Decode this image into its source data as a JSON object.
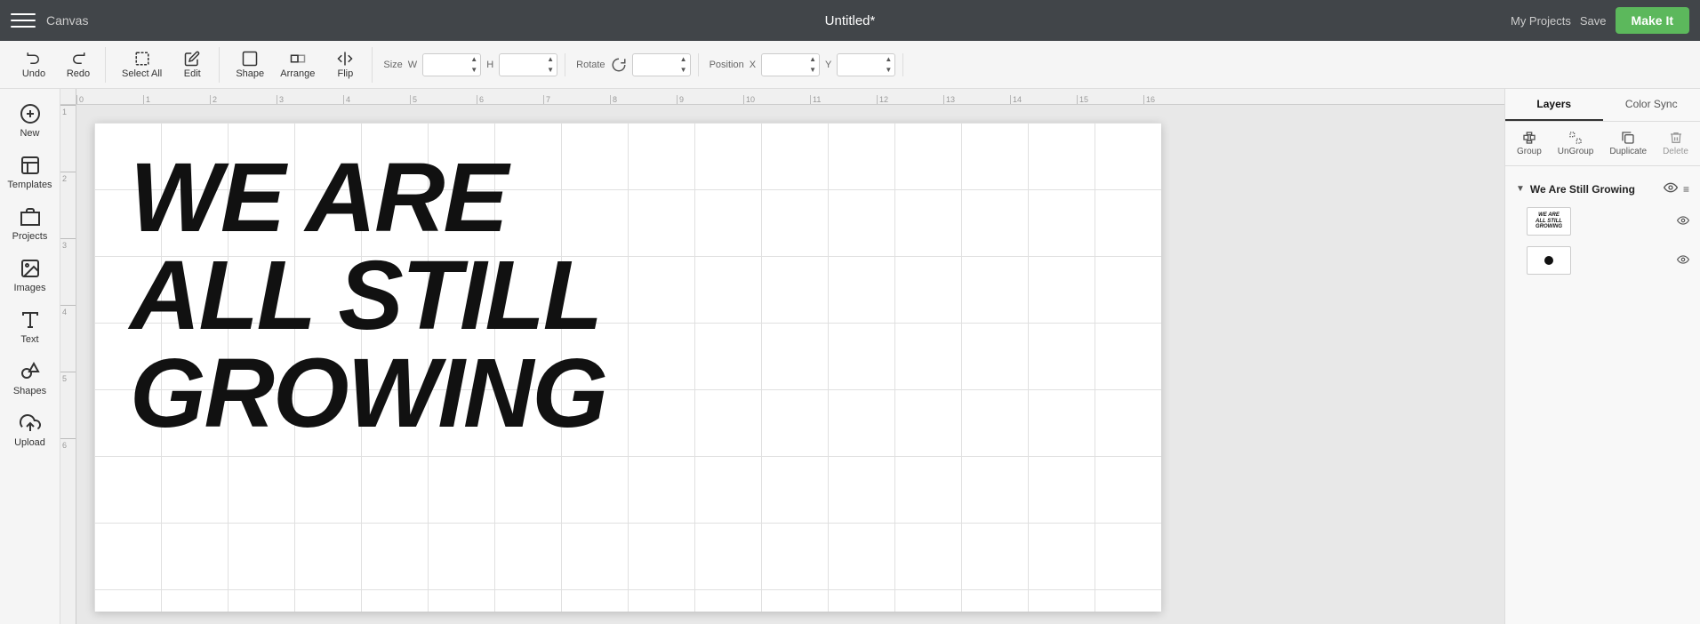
{
  "header": {
    "menu_label": "Menu",
    "canvas_label": "Canvas",
    "title": "Untitled*",
    "my_projects_label": "My Projects",
    "save_label": "Save",
    "make_it_label": "Make It"
  },
  "toolbar": {
    "undo_label": "Undo",
    "redo_label": "Redo",
    "select_all_label": "Select All",
    "edit_label": "Edit",
    "shape_label": "Shape",
    "arrange_label": "Arrange",
    "flip_label": "Flip",
    "size_label": "Size",
    "rotate_label": "Rotate",
    "position_label": "Position",
    "w_label": "W",
    "h_label": "H",
    "rotate_field_label": "",
    "x_label": "X",
    "y_label": "Y",
    "w_value": "",
    "h_value": "",
    "rotate_value": "",
    "x_value": "",
    "y_value": ""
  },
  "sidebar": {
    "items": [
      {
        "id": "new",
        "label": "New",
        "icon": "new-icon"
      },
      {
        "id": "templates",
        "label": "Templates",
        "icon": "templates-icon"
      },
      {
        "id": "projects",
        "label": "Projects",
        "icon": "projects-icon"
      },
      {
        "id": "images",
        "label": "Images",
        "icon": "images-icon"
      },
      {
        "id": "text",
        "label": "Text",
        "icon": "text-icon"
      },
      {
        "id": "shapes",
        "label": "Shapes",
        "icon": "shapes-icon"
      },
      {
        "id": "upload",
        "label": "Upload",
        "icon": "upload-icon"
      }
    ]
  },
  "canvas": {
    "text_art_line1": "WE ARE",
    "text_art_line2": "ALL STILL",
    "text_art_line3": "GROWING"
  },
  "right_panel": {
    "tab_layers": "Layers",
    "tab_color_sync": "Color Sync",
    "actions": {
      "group_label": "Group",
      "ungroup_label": "UnGroup",
      "duplicate_label": "Duplicate",
      "delete_label": "Delete"
    },
    "layer_group_title": "We Are Still Growing",
    "layer_items": [
      {
        "id": "text-layer",
        "type": "text"
      },
      {
        "id": "circle-layer",
        "type": "circle"
      }
    ]
  },
  "ruler": {
    "top_marks": [
      "0",
      "1",
      "2",
      "3",
      "4",
      "5",
      "6",
      "7",
      "8",
      "9",
      "10",
      "11",
      "12",
      "13",
      "14",
      "15",
      "16"
    ],
    "left_marks": [
      "1",
      "2",
      "3",
      "4",
      "5",
      "6"
    ]
  }
}
